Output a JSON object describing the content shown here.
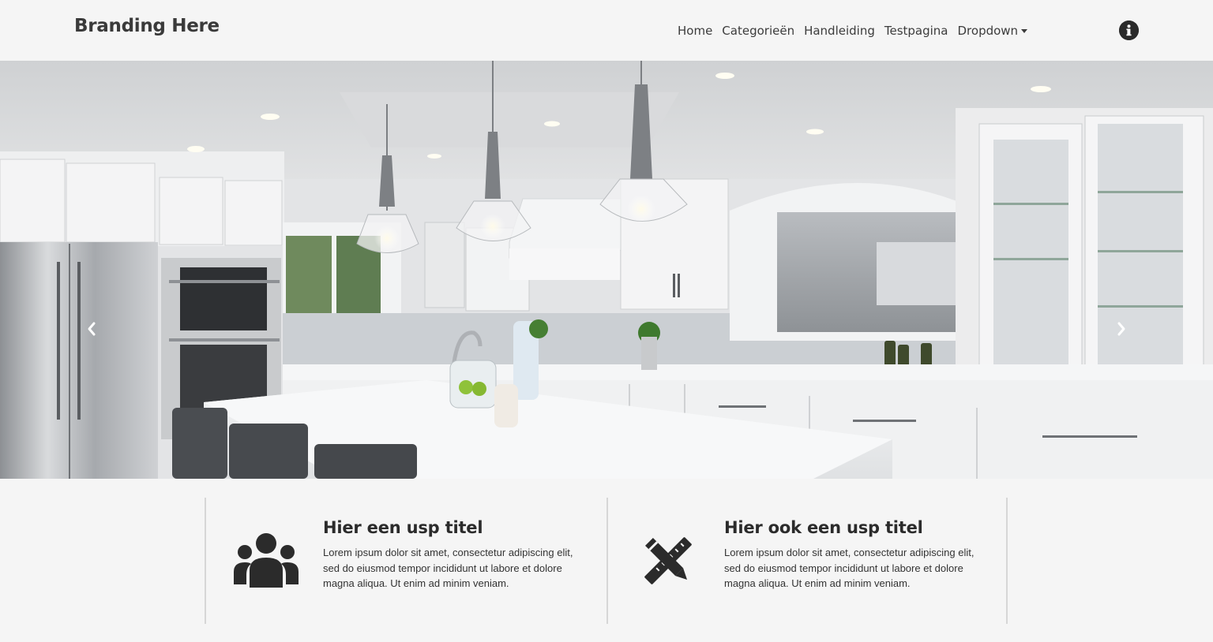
{
  "navbar": {
    "brand": "Branding Here",
    "links": [
      {
        "label": "Home"
      },
      {
        "label": "Categorieën"
      },
      {
        "label": "Handleiding"
      },
      {
        "label": "Testpagina"
      },
      {
        "label": "Dropdown",
        "has_dropdown": true
      }
    ],
    "info_icon": "info-circle-icon"
  },
  "hero": {
    "prev_icon": "chevron-left-icon",
    "next_icon": "chevron-right-icon"
  },
  "usps": [
    {
      "icon": "users-icon",
      "title": "Hier een usp titel",
      "text": "Lorem ipsum dolor sit amet, consectetur adipiscing elit, sed do eiusmod tempor incididunt ut labore et dolore magna aliqua. Ut enim ad minim veniam."
    },
    {
      "icon": "pencil-ruler-icon",
      "title": "Hier ook een usp titel",
      "text": "Lorem ipsum dolor sit amet, consectetur adipiscing elit, sed do eiusmod tempor incididunt ut labore et dolore magna aliqua. Ut enim ad minim veniam."
    }
  ],
  "colors": {
    "background": "#f5f5f5",
    "text_dark": "#2b2b2b",
    "divider": "#d6d6d6"
  }
}
